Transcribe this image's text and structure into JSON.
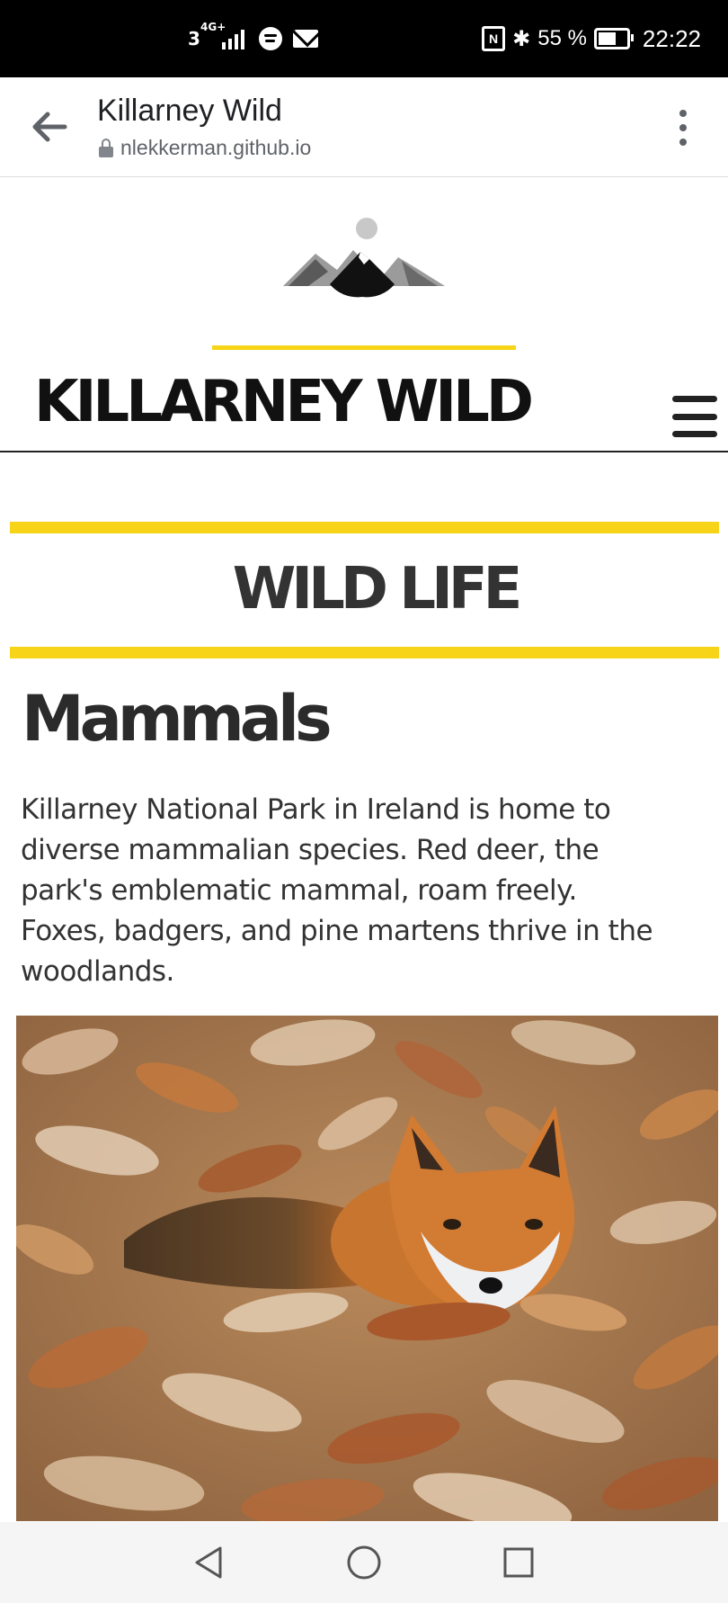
{
  "status_bar": {
    "carrier": "3",
    "network": "4G+",
    "battery": "55 %",
    "time": "22:22",
    "icons": [
      "signal-icon",
      "spotify-icon",
      "mail-icon",
      "nfc-icon",
      "bluetooth-icon",
      "battery-icon"
    ]
  },
  "browser": {
    "title": "Killarney Wild",
    "url": "nlekkerman.github.io"
  },
  "site": {
    "brand": "KILLARNEY WILD",
    "accent_color": "#f7d417"
  },
  "section": {
    "title": "WILD LIFE",
    "subtitle": "Mammals",
    "body": "Killarney National Park in Ireland is home to diverse mammalian species. Red deer, the park's emblematic mammal, roam freely. Foxes, badgers, and pine martens thrive in the woodlands."
  },
  "photo": {
    "subject": "fox lying in autumn leaves"
  },
  "nav_bar": {
    "buttons": [
      "back-icon",
      "home-icon",
      "recents-icon"
    ]
  }
}
